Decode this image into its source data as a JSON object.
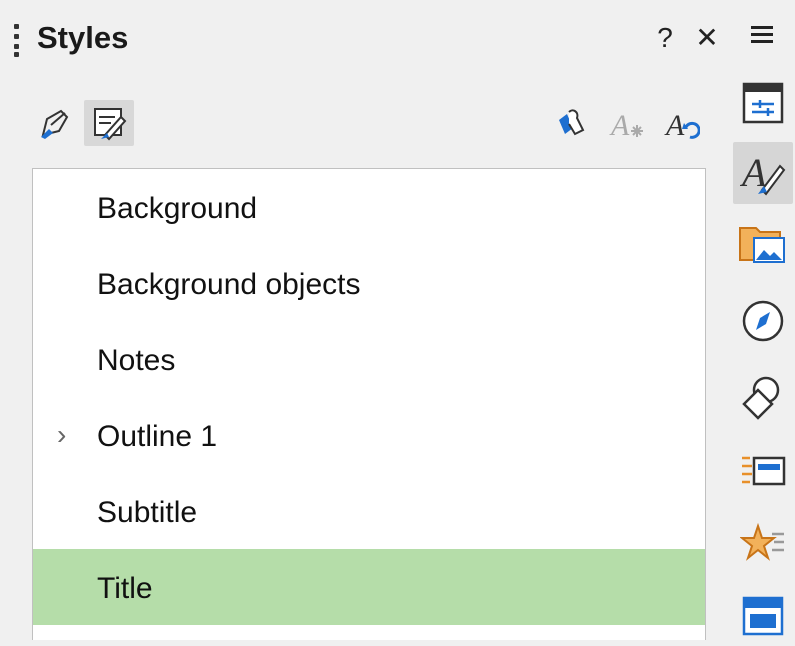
{
  "panel": {
    "title": "Styles",
    "help_label": "?",
    "close_label": "✕"
  },
  "style_list": [
    {
      "label": "Background",
      "expandable": false,
      "selected": false
    },
    {
      "label": "Background objects",
      "expandable": false,
      "selected": false
    },
    {
      "label": "Notes",
      "expandable": false,
      "selected": false
    },
    {
      "label": "Outline 1",
      "expandable": true,
      "selected": false
    },
    {
      "label": "Subtitle",
      "expandable": false,
      "selected": false
    },
    {
      "label": "Title",
      "expandable": false,
      "selected": true
    }
  ],
  "toolbar": {
    "left": [
      "drawing-styles-icon",
      "presentation-styles-icon"
    ],
    "right": [
      "fill-format-mode-icon",
      "new-style-from-selection-icon",
      "update-style-icon"
    ]
  },
  "sidebar_tabs": [
    "properties-icon",
    "styles-icon",
    "gallery-icon",
    "navigator-icon",
    "shapes-icon",
    "animation-icon",
    "slide-transition-icon",
    "master-slides-icon"
  ],
  "colors": {
    "selected_row": "#b5dda9",
    "accent_blue": "#1e6fd0",
    "accent_orange": "#e8902a"
  }
}
